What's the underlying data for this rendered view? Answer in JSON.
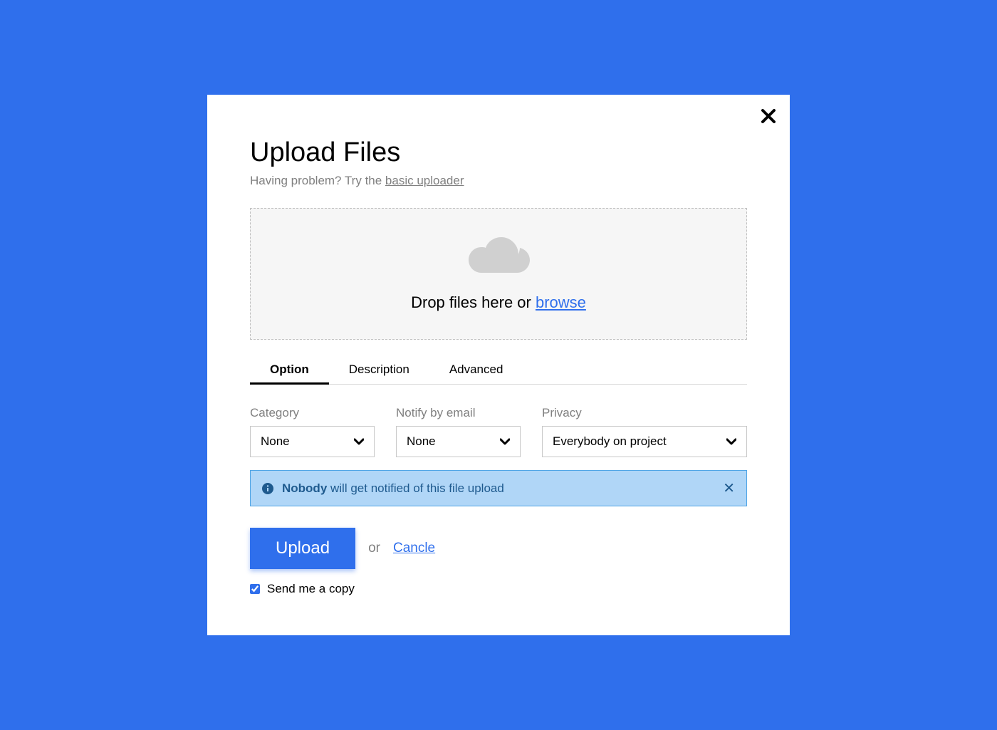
{
  "modal": {
    "title": "Upload Files",
    "subtitle_prefix": "Having problem? Try the ",
    "subtitle_link": "basic uploader"
  },
  "dropzone": {
    "text_prefix": "Drop files here or ",
    "browse": "browse"
  },
  "tabs": [
    {
      "label": "Option",
      "active": true
    },
    {
      "label": "Description",
      "active": false
    },
    {
      "label": "Advanced",
      "active": false
    }
  ],
  "form": {
    "category": {
      "label": "Category",
      "value": "None"
    },
    "notify": {
      "label": "Notify by email",
      "value": "None"
    },
    "privacy": {
      "label": "Privacy",
      "value": "Everybody on project"
    }
  },
  "alert": {
    "bold": "Nobody",
    "rest": " will get notified of this file upload"
  },
  "actions": {
    "upload": "Upload",
    "or": "or",
    "cancel": "Cancle"
  },
  "checkbox": {
    "label": "Send me a copy",
    "checked": true
  }
}
